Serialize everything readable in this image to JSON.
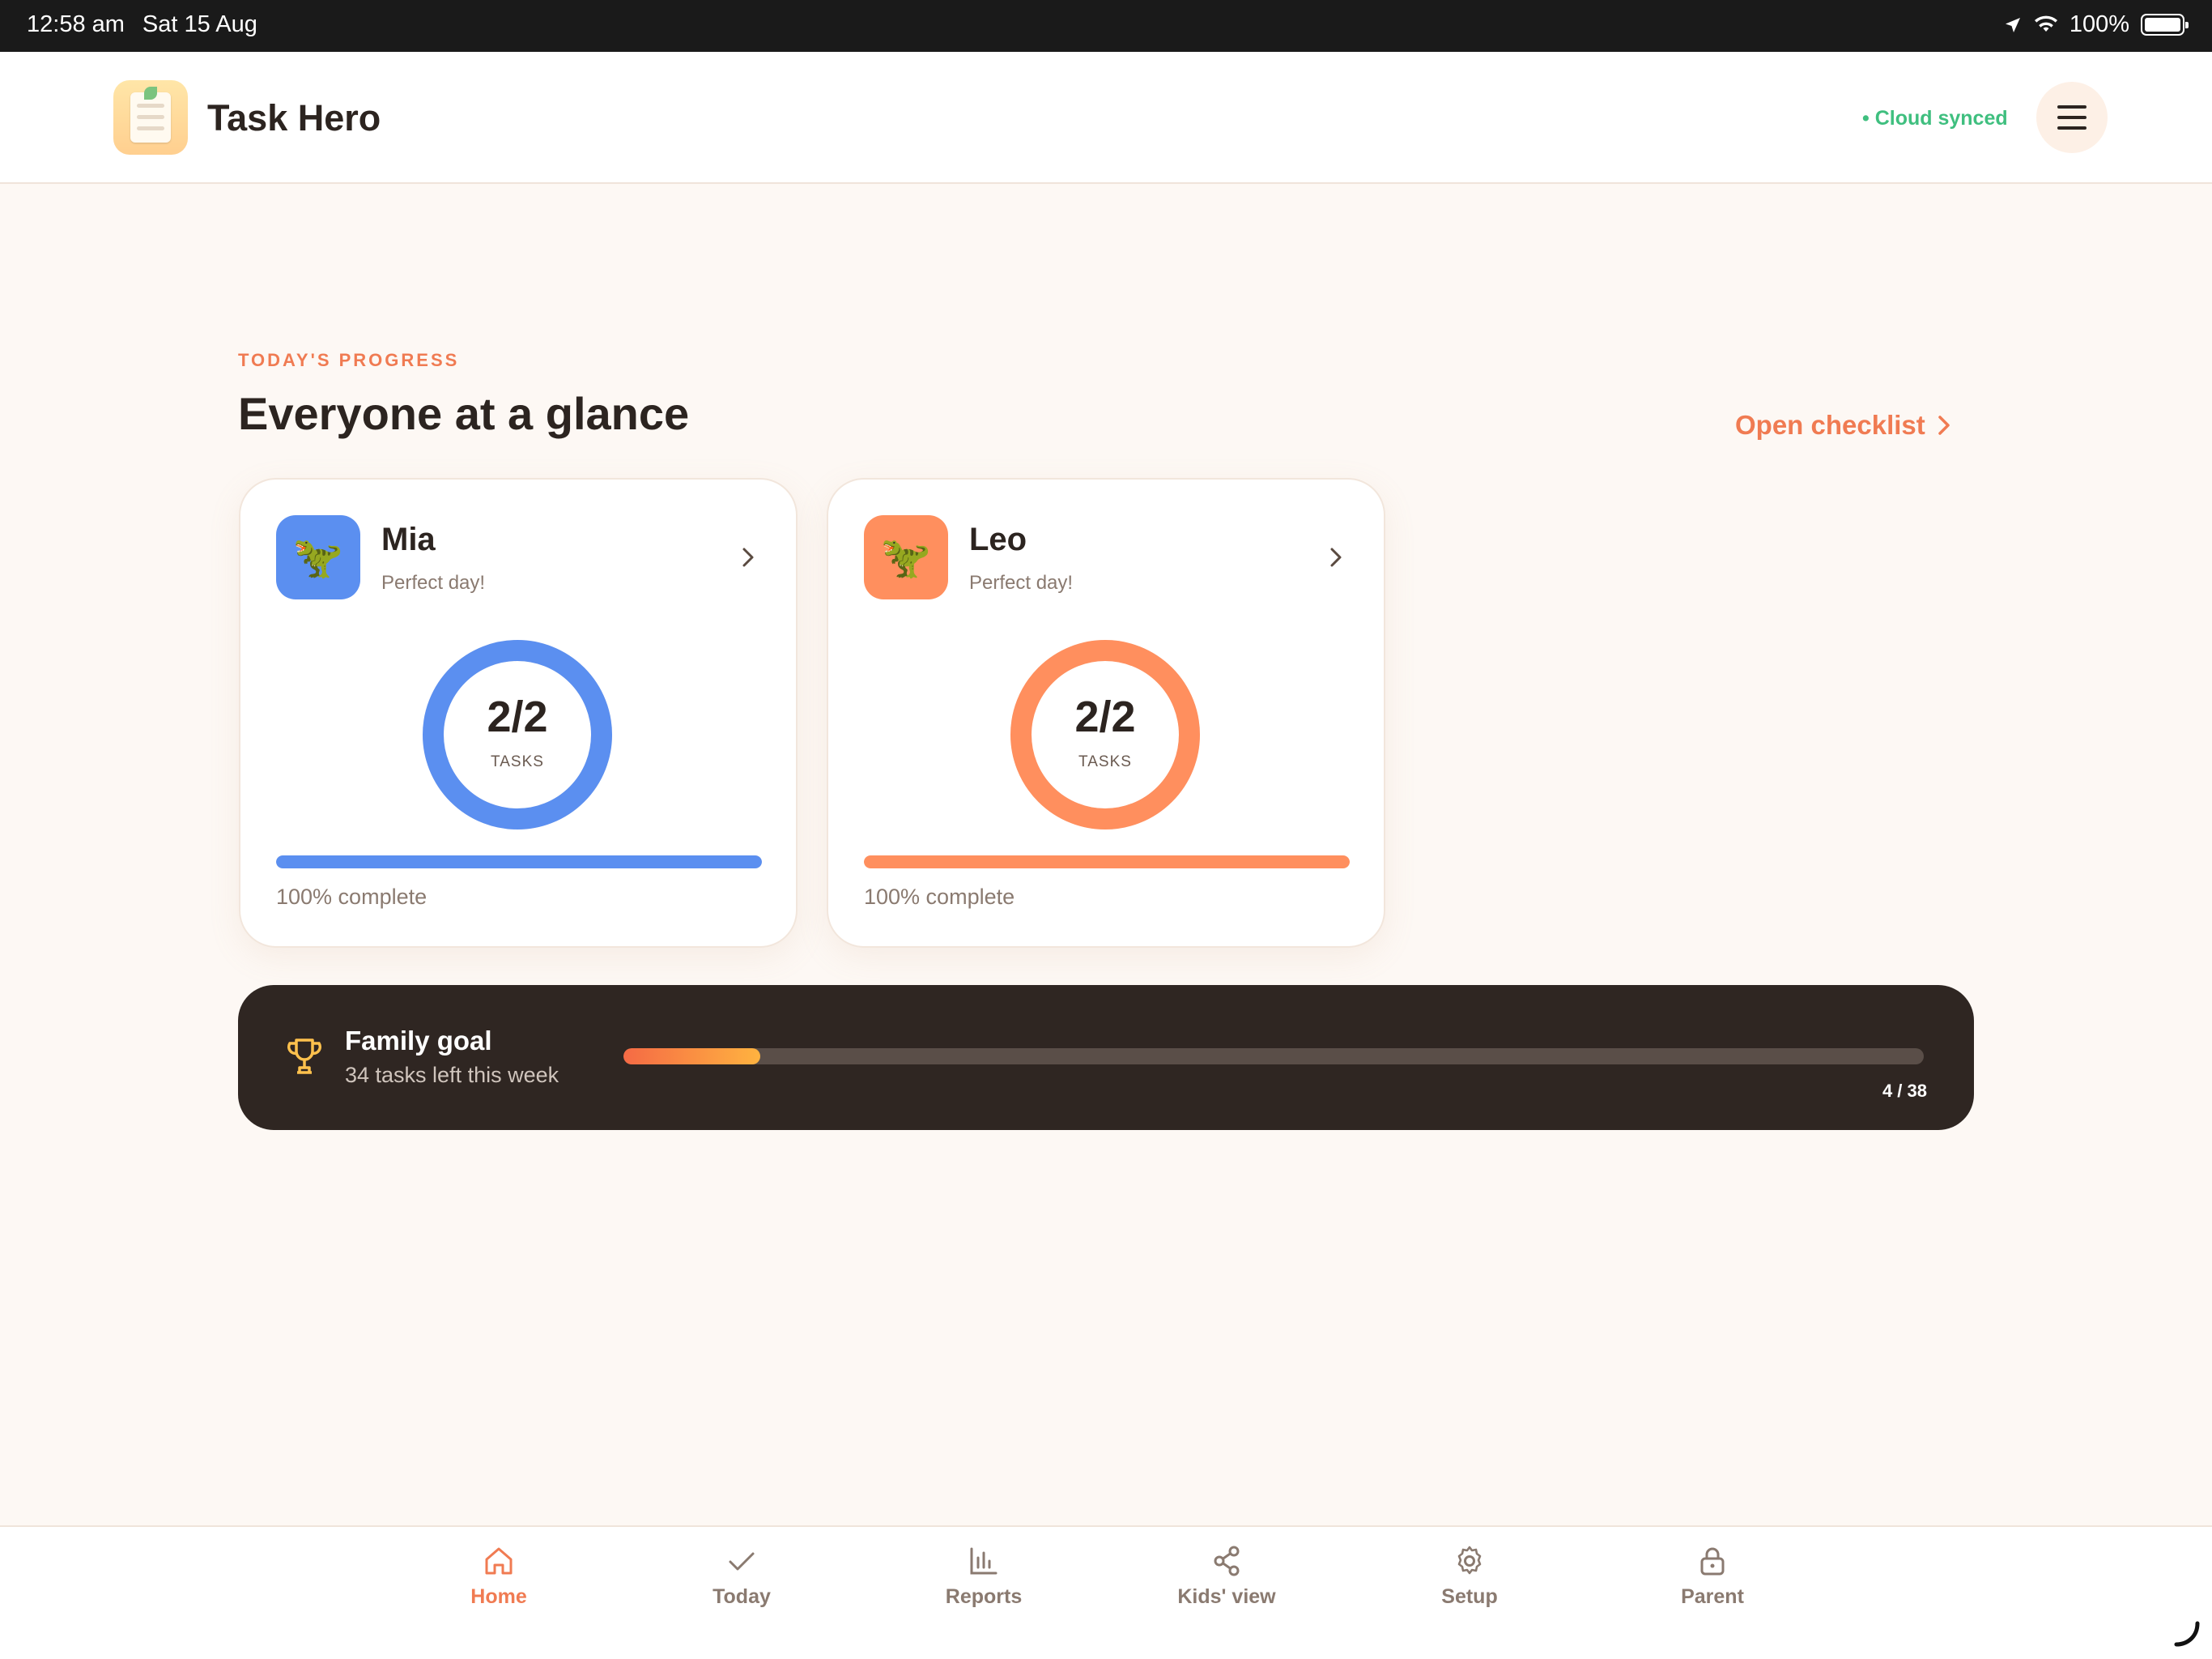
{
  "status_bar": {
    "time": "12:58 am",
    "date": "Sat 15 Aug",
    "battery": "100%"
  },
  "header": {
    "app_title": "Task Hero",
    "sync_status": "• Cloud synced"
  },
  "section": {
    "eyebrow": "TODAY'S PROGRESS",
    "title": "Everyone at a glance",
    "open_link": "Open checklist"
  },
  "kids": [
    {
      "name": "Mia",
      "status": "Perfect day!",
      "avatar": "🦖",
      "count": "2/2",
      "count_label": "TASKS",
      "percent_text": "100% complete",
      "progress": 1.0,
      "color": "#5b8ff0"
    },
    {
      "name": "Leo",
      "status": "Perfect day!",
      "avatar": "🦖",
      "count": "2/2",
      "count_label": "TASKS",
      "percent_text": "100% complete",
      "progress": 1.0,
      "color": "#ff8f5e"
    }
  ],
  "goal": {
    "title": "Family goal",
    "subtitle": "34 tasks left this week",
    "count": "4 / 38",
    "done": 4,
    "total": 38
  },
  "nav": [
    {
      "label": "Home",
      "icon": "home-icon",
      "active": true
    },
    {
      "label": "Today",
      "icon": "check-icon",
      "active": false
    },
    {
      "label": "Reports",
      "icon": "bar-chart-icon",
      "active": false
    },
    {
      "label": "Kids' view",
      "icon": "share-icon",
      "active": false
    },
    {
      "label": "Setup",
      "icon": "gear-icon",
      "active": false
    },
    {
      "label": "Parent",
      "icon": "lock-icon",
      "active": false
    }
  ],
  "colors": {
    "accent": "#f07b52",
    "sync": "#3fbf7f",
    "dark_panel": "#2f2622"
  }
}
